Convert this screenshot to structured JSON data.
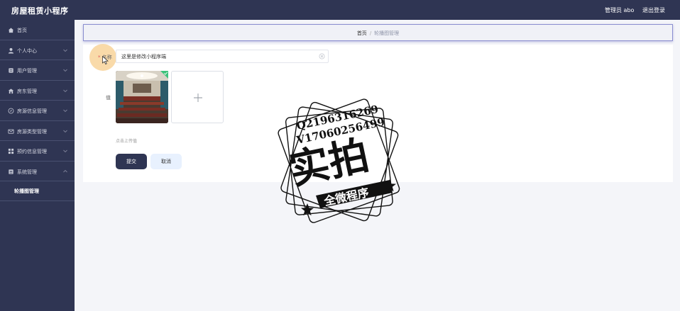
{
  "app": {
    "title": "房屋租赁小程序"
  },
  "header": {
    "user": "管理员 abo",
    "logout": "退出登录"
  },
  "sidebar": {
    "items": [
      {
        "label": "首页",
        "icon": "home-icon"
      },
      {
        "label": "个人中心",
        "icon": "user-icon",
        "expandable": true
      },
      {
        "label": "用户管理",
        "icon": "document-icon",
        "expandable": true
      },
      {
        "label": "房东管理",
        "icon": "house-icon",
        "expandable": true
      },
      {
        "label": "房源信息管理",
        "icon": "compass-icon",
        "expandable": true
      },
      {
        "label": "房源类型管理",
        "icon": "mail-icon",
        "expandable": true
      },
      {
        "label": "预约信息管理",
        "icon": "grid-icon",
        "expandable": true
      },
      {
        "label": "系统管理",
        "icon": "list-icon",
        "expandable": true,
        "expanded": true
      }
    ],
    "submenu": [
      {
        "label": "轮播图管理"
      }
    ]
  },
  "breadcrumb": {
    "home": "首页",
    "separator": "/",
    "current": "轮播图管理"
  },
  "form": {
    "name_required_mark": "*",
    "name_label": "名称",
    "name_value": "这里是修改小程序端",
    "value_label": "值",
    "upload_hint": "点击上传值",
    "submit_label": "提交",
    "cancel_label": "取消"
  },
  "watermark": {
    "line1": "Q2196316269",
    "line2": "V17060256499",
    "main": "实拍",
    "banner": "全微程序"
  },
  "colors": {
    "sidebar_bg": "#2f3553",
    "accent_border": "#8b8fd0",
    "success": "#3cc27a",
    "required": "#e05a5a"
  }
}
